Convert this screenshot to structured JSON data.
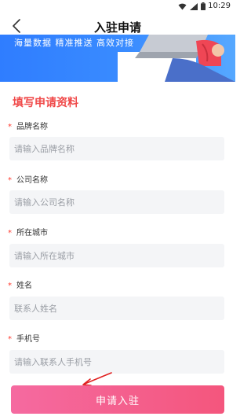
{
  "status_bar": {
    "time": "10:29"
  },
  "nav": {
    "title": "入驻申请"
  },
  "banner": {
    "text": "海量数据  精准推送  高效对接"
  },
  "form": {
    "section_title": "填写申请资料",
    "fields": [
      {
        "label": "品牌名称",
        "placeholder": "请输入品牌名称"
      },
      {
        "label": "公司名称",
        "placeholder": "请输入公司名称"
      },
      {
        "label": "所在城市",
        "placeholder": "请输入所在城市"
      },
      {
        "label": "姓名",
        "placeholder": "联系人姓名"
      },
      {
        "label": "手机号",
        "placeholder": "请输入联系人手机号"
      }
    ],
    "required_mark": "*",
    "submit_label": "申请入驻"
  },
  "colors": {
    "accent_red": "#f04a4a",
    "required_red": "#ff3b30",
    "button_gradient_start": "#f56aa0",
    "button_gradient_end": "#f4567d",
    "banner_blue": "#2f7dff",
    "annotation_arrow": "#e02020"
  },
  "icons": {
    "back": "chevron-left-icon",
    "wifi": "wifi-icon",
    "signal": "signal-icon",
    "battery": "battery-icon"
  }
}
